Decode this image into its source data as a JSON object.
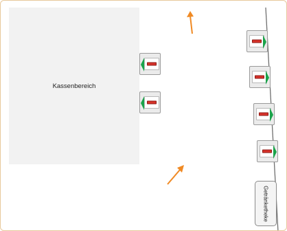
{
  "floor_plan": {
    "checkout_area": {
      "label": "Kassenbereich"
    },
    "drinks_counter": {
      "label": "Getränketheke"
    },
    "stations_left_count": 2,
    "stations_right_count": 4,
    "colors": {
      "accent_arrow": "#f08a24",
      "status_green": "#1aa34a",
      "status_red": "#d9332b",
      "zone_fill": "#f2f2f2",
      "frame_border": "#e8c89a"
    },
    "icons": [
      "orange-arrow-icon",
      "station-icon",
      "green-status-icon",
      "red-status-icon"
    ]
  }
}
